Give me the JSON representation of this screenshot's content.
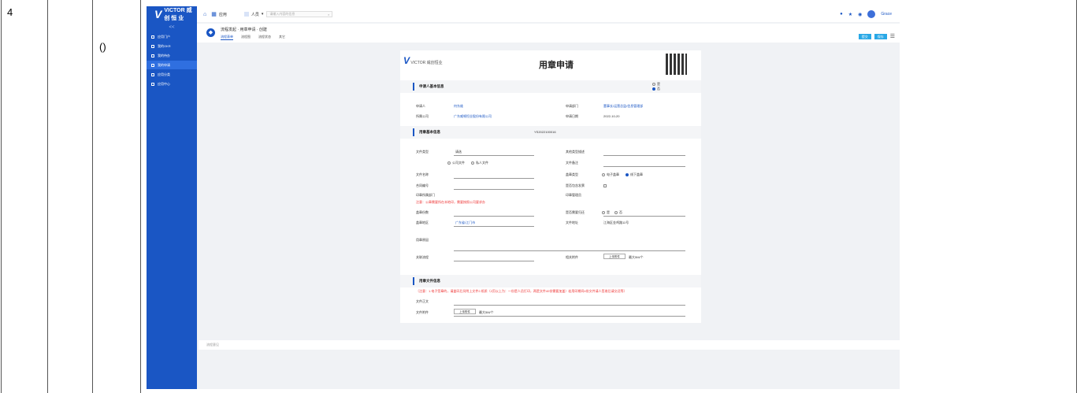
{
  "table": {
    "row_number": "4",
    "paren_text": "()"
  },
  "sidebar": {
    "logo_text": "VICTOR 威 创 恒 业",
    "collapse": "<<",
    "items": [
      {
        "label": "应用门户"
      },
      {
        "label": "我的OKR"
      },
      {
        "label": "我的待办"
      },
      {
        "label": "我的申请",
        "active": true
      },
      {
        "label": "应用分类"
      },
      {
        "label": "应用中心"
      }
    ]
  },
  "topbar": {
    "home_label": "应用",
    "grid_label": "应用",
    "person_label": "人员",
    "search_placeholder": "请输入内容的信息",
    "user_name": "Grace"
  },
  "crumb": {
    "title": "流程发起 · 用章申请 · 创建",
    "tabs": [
      "流程表单",
      "流程图",
      "流程状态",
      "其它"
    ],
    "submit": "提交",
    "save": "保存"
  },
  "form": {
    "logo_sub": "VICTOR 威创恒业",
    "title": "用章申请",
    "sections": {
      "applicant": "申请人基本信息",
      "seal": "用章基本信息",
      "file": "用章文件信息"
    },
    "applicant_options": [
      "是",
      "否"
    ],
    "fields": {
      "applicant_label": "申请人",
      "applicant_value": "何东维",
      "dept_label": "申请部门",
      "dept_value": "董事长/运营总监/信息管理部",
      "company_label": "所属公司",
      "company_value": "广东威顿恒业股份有限公司",
      "date_label": "申请日期",
      "date_value": "2022-10-20",
      "seal_no": "YS2022100016",
      "file_type_label": "文件类型",
      "file_type_value": "请选",
      "file_type_opts": [
        "公司文件",
        "私人文件"
      ],
      "other_desc_label": "其他类型描述",
      "file_name_label": "文件名称",
      "file_note_label": "文件备注",
      "seal_type_label": "盖章类型",
      "seal_type_opts": [
        "电子盖章",
        "线下盖章"
      ],
      "contract_label": "合同编号",
      "contract_flag_label": "是否包含发票",
      "contract_dept_label": "印章所属部门",
      "seal_manager_label": "印章管理员",
      "warn_text": "注意：公章需要所在本地印，需要按照公司要求办",
      "seal_count_label": "盖章份数",
      "return_label": "是否需要归还",
      "return_opts": [
        "是",
        "否"
      ],
      "region_label": "盖章地区",
      "region_value": "广东省/江门市",
      "address_label": "文件地址",
      "address_value": "江海区金鸡路11号",
      "reason_label": "用章原因",
      "related_label": "关联流程",
      "attach_label": "相关附件",
      "upload_label": "上传附件",
      "limit_label": "最大5M/个",
      "file_warn": "（注意：1.电子签章的，请盖印后另附上文件2.纸质（2页以上为：一份是人员打印，两是文件40份需要加盖）若用印期间4份文件请人签收后请交还等）",
      "file_body_label": "文件正文",
      "file_attach_label": "文件附件",
      "file_upload": "上传附件",
      "file_limit": "最大5M/个"
    }
  },
  "footer_note": "流程意见"
}
